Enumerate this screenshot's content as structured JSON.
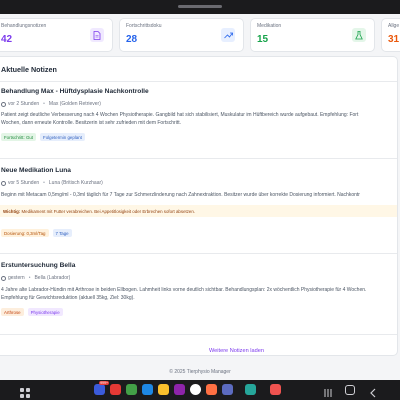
{
  "stats": [
    {
      "label": "Behandlungsnotizen",
      "value": "42",
      "color": "#7c3aed",
      "icon": "document-icon",
      "iconBg": "#f0e9ff"
    },
    {
      "label": "Fortschrittsdoku",
      "value": "28",
      "color": "#2563eb",
      "icon": "trend-up-icon",
      "iconBg": "#e7efff"
    },
    {
      "label": "Medikation",
      "value": "15",
      "color": "#16a34a",
      "icon": "flask-icon",
      "iconBg": "#e4f6e9"
    },
    {
      "label": "Allge",
      "value": "31",
      "color": "#ea580c",
      "icon": "",
      "iconBg": ""
    }
  ],
  "panel": {
    "title": "Aktuelle Notizen",
    "notes": [
      {
        "title": "Behandlung Max - Hüftdysplasie Nachkontrolle",
        "time": "vor 2 Stunden",
        "patient": "Max (Golden Retriever)",
        "body": [
          "Patient zeigt deutliche Verbesserung nach 4 Wochen Physiotherapie. Gangbild hat sich stabilisiert, Muskulatur im Hüftbereich wurde aufgebaut. Empfehlung: Fort",
          "Wochen, dann erneute Kontrolle. Besitzerin ist sehr zufrieden mit dem Fortschritt."
        ],
        "tags": [
          {
            "text": "Fortschritt: Gut",
            "bg": "#e3f5e6",
            "fg": "#1f8a3b"
          },
          {
            "text": "Folgetermin geplant",
            "bg": "#e6eefc",
            "fg": "#2f5fbf"
          }
        ]
      },
      {
        "title": "Neue Medikation Luna",
        "time": "vor 5 Stunden",
        "patient": "Luna (Britisch Kurzhaar)",
        "body": [
          "Beginn mit Metacam 0,5mg/ml - 0,3ml täglich für 7 Tage zur Schmerzlinderung nach Zahnextraktion. Besitzer wurde über korrekte Dosierung informiert. Nachkontr"
        ],
        "warning_label": "Wichtig:",
        "warning_text": "Medikament mit Futter verabreichen. Bei Appetitlosigkeit oder Erbrechen sofort absetzen.",
        "tags": [
          {
            "text": "Dosierung: 0,3ml/Tag",
            "bg": "#fff1dc",
            "fg": "#b45309"
          },
          {
            "text": "7 Tage",
            "bg": "#e6eefc",
            "fg": "#2f5fbf"
          }
        ]
      },
      {
        "title": "Erstuntersuchung Bella",
        "time": "gestern",
        "patient": "Bella (Labrador)",
        "body": [
          "4 Jahre alte Labrador-Hündin mit Arthrose in beiden Ellbogen. Lahmheit links vorne deutlich sichtbar. Behandlungsplan: 2x wöchentlich Physiotherapie für 4 Wochen.",
          "Empfehlung für Gewichtsreduktion (aktuell 35kg, Ziel: 30kg)."
        ],
        "tags": [
          {
            "text": "Arthrose",
            "bg": "#fdeedd",
            "fg": "#c2410c"
          },
          {
            "text": "Physiotherapie",
            "bg": "#f1e8ff",
            "fg": "#7c3aed"
          }
        ]
      }
    ],
    "more_label": "Weitere Notizen laden"
  },
  "footer": "© 2025 Tierphysio Manager",
  "navbar": {
    "badge": "999+"
  }
}
